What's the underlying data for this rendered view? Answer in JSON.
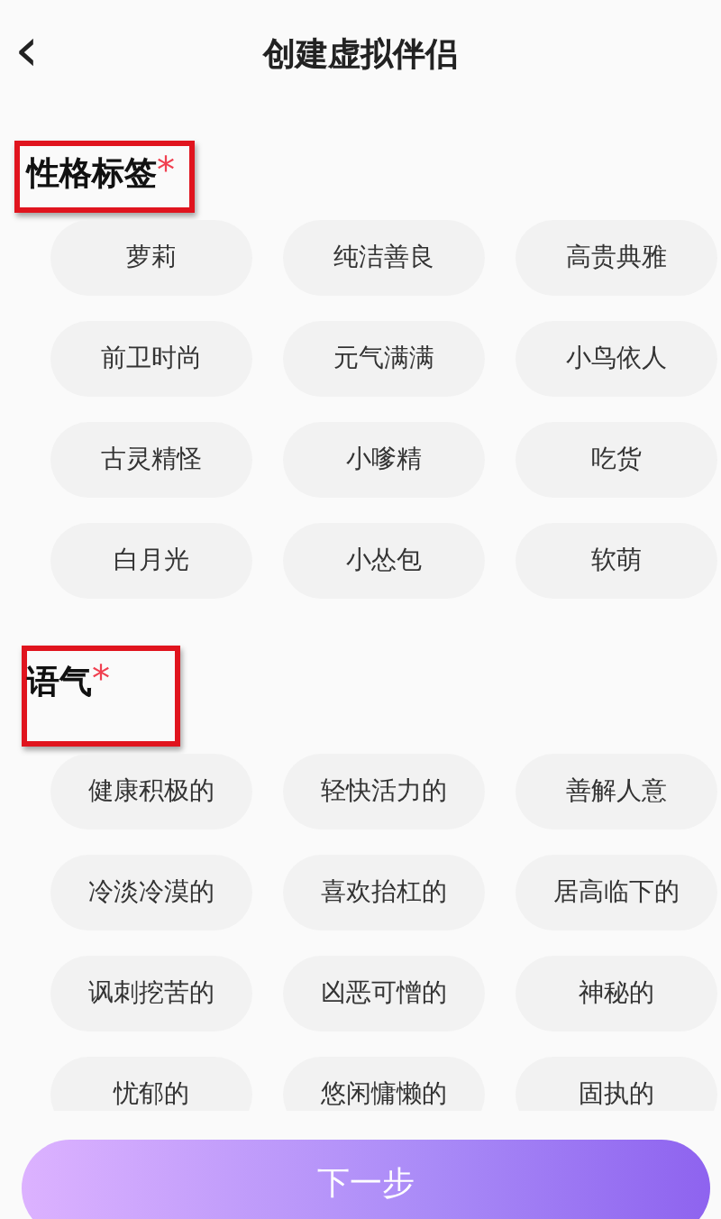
{
  "header": {
    "back_icon": "‹",
    "title": "创建虚拟伴侣"
  },
  "sections": [
    {
      "title": "性格标签",
      "required_mark": "*",
      "highlighted": true,
      "clipped": false,
      "tags": [
        {
          "label": "萝莉",
          "selected": false
        },
        {
          "label": "纯洁善良",
          "selected": false
        },
        {
          "label": "高贵典雅",
          "selected": false
        },
        {
          "label": "前卫时尚",
          "selected": false
        },
        {
          "label": "元气满满",
          "selected": false
        },
        {
          "label": "小鸟依人",
          "selected": false
        },
        {
          "label": "古灵精怪",
          "selected": false
        },
        {
          "label": "小嗲精",
          "selected": false
        },
        {
          "label": "吃货",
          "selected": false
        },
        {
          "label": "白月光",
          "selected": false
        },
        {
          "label": "小怂包",
          "selected": false
        },
        {
          "label": "软萌",
          "selected": false
        }
      ]
    },
    {
      "title": "语气",
      "required_mark": "*",
      "highlighted": true,
      "clipped": true,
      "tags": [
        {
          "label": "健康积极的",
          "selected": false
        },
        {
          "label": "轻快活力的",
          "selected": false
        },
        {
          "label": "善解人意",
          "selected": false
        },
        {
          "label": "冷淡冷漠的",
          "selected": false
        },
        {
          "label": "喜欢抬杠的",
          "selected": false
        },
        {
          "label": "居高临下的",
          "selected": false
        },
        {
          "label": "讽刺挖苦的",
          "selected": false
        },
        {
          "label": "凶恶可憎的",
          "selected": false
        },
        {
          "label": "神秘的",
          "selected": false
        },
        {
          "label": "忧郁的",
          "selected": false
        },
        {
          "label": "悠闲慵懒的",
          "selected": false
        },
        {
          "label": "固执的",
          "selected": false
        }
      ]
    }
  ],
  "next_button": "下一步"
}
